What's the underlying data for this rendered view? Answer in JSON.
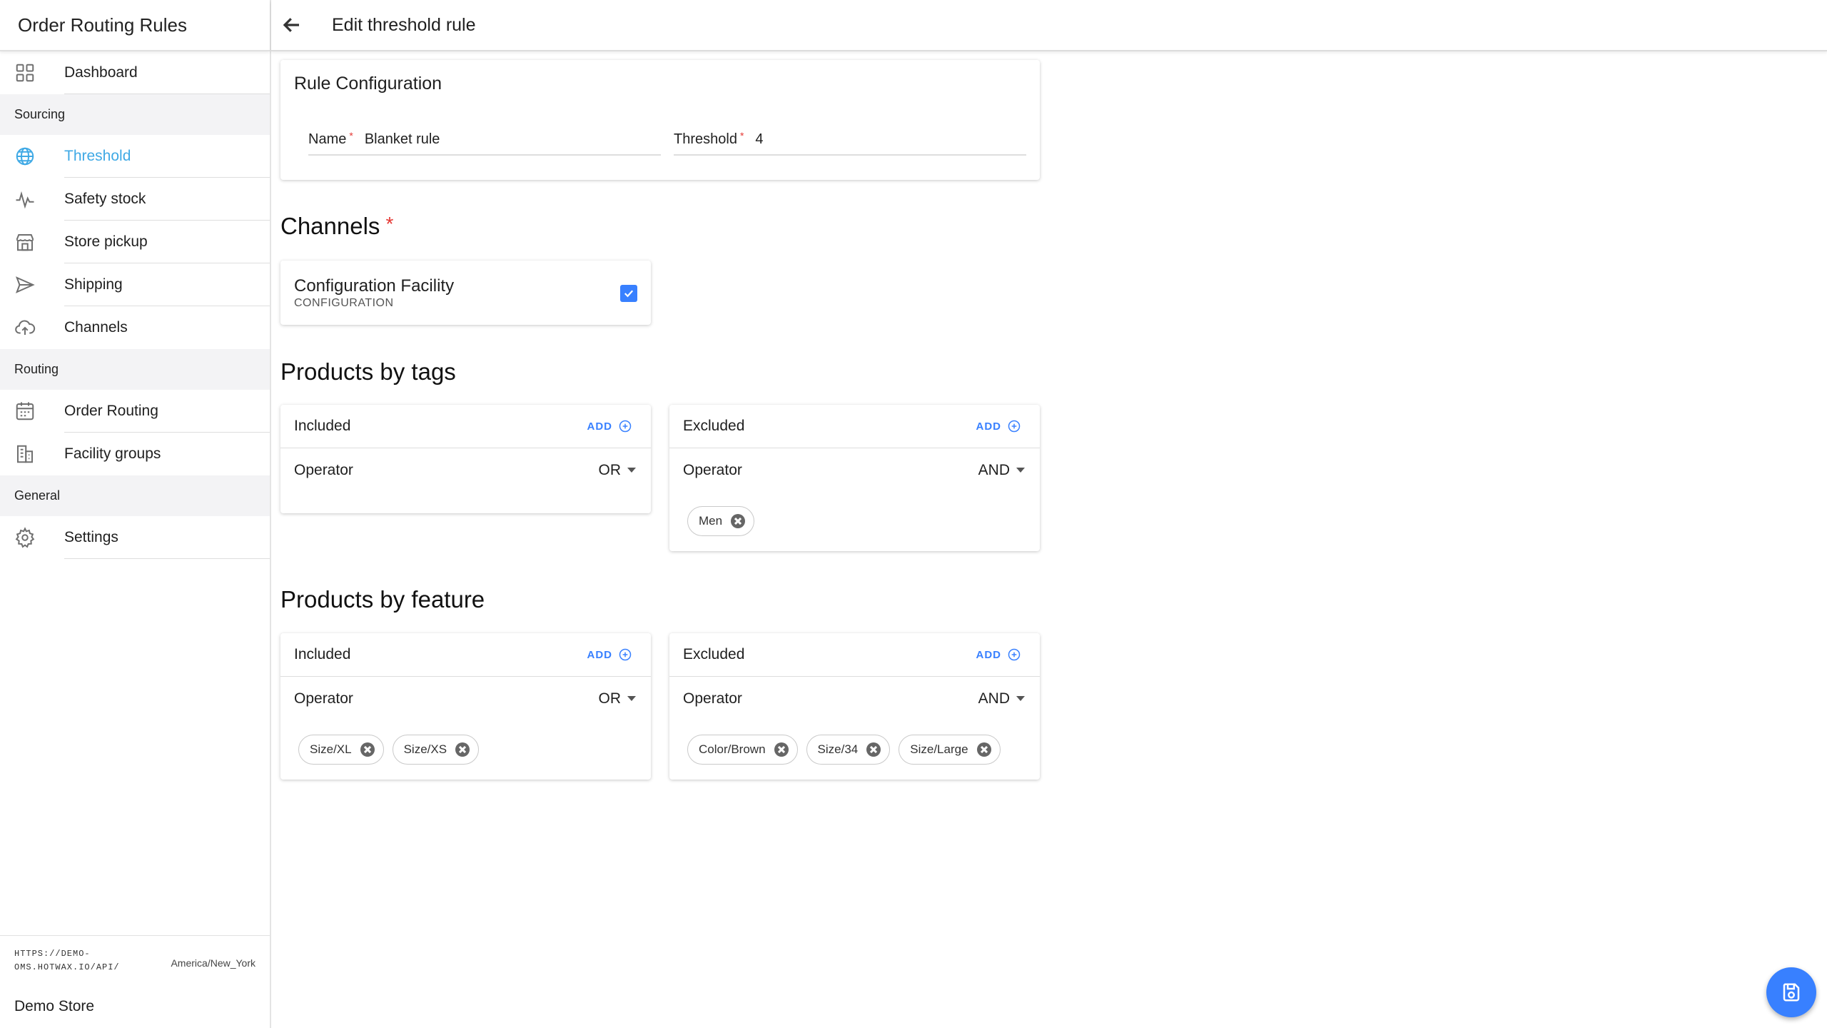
{
  "sidebar": {
    "title": "Order Routing Rules",
    "dashboard": "Dashboard",
    "sections": {
      "sourcing": "Sourcing",
      "routing": "Routing",
      "general": "General"
    },
    "items": {
      "threshold": "Threshold",
      "safety_stock": "Safety stock",
      "store_pickup": "Store pickup",
      "shipping": "Shipping",
      "channels": "Channels",
      "order_routing": "Order Routing",
      "facility_groups": "Facility groups",
      "settings": "Settings"
    },
    "active_item": "threshold",
    "footer": {
      "url": "HTTPS://DEMO-OMS.HOTWAX.IO/API/",
      "timezone": "America/New_York",
      "store": "Demo Store"
    }
  },
  "header": {
    "title": "Edit threshold rule"
  },
  "rule_config": {
    "title": "Rule Configuration",
    "name_label": "Name",
    "name_value": "Blanket rule",
    "threshold_label": "Threshold",
    "threshold_value": "4",
    "required_mark": "*"
  },
  "channels": {
    "title": "Channels",
    "required_mark": "*",
    "item_name": "Configuration Facility",
    "item_sub": "CONFIGURATION",
    "checked": true
  },
  "products_by_tags": {
    "title": "Products by tags",
    "included": {
      "title": "Included",
      "add_label": "ADD",
      "operator_label": "Operator",
      "operator_value": "OR",
      "chips": []
    },
    "excluded": {
      "title": "Excluded",
      "add_label": "ADD",
      "operator_label": "Operator",
      "operator_value": "AND",
      "chips": [
        "Men"
      ]
    }
  },
  "products_by_feature": {
    "title": "Products by feature",
    "included": {
      "title": "Included",
      "add_label": "ADD",
      "operator_label": "Operator",
      "operator_value": "OR",
      "chips": [
        "Size/XL",
        "Size/XS"
      ]
    },
    "excluded": {
      "title": "Excluded",
      "add_label": "ADD",
      "operator_label": "Operator",
      "operator_value": "AND",
      "chips": [
        "Color/Brown",
        "Size/34",
        "Size/Large"
      ]
    }
  },
  "colors": {
    "accent": "#3880ff",
    "active_nav": "#3fa9e5",
    "required": "#e53935"
  }
}
